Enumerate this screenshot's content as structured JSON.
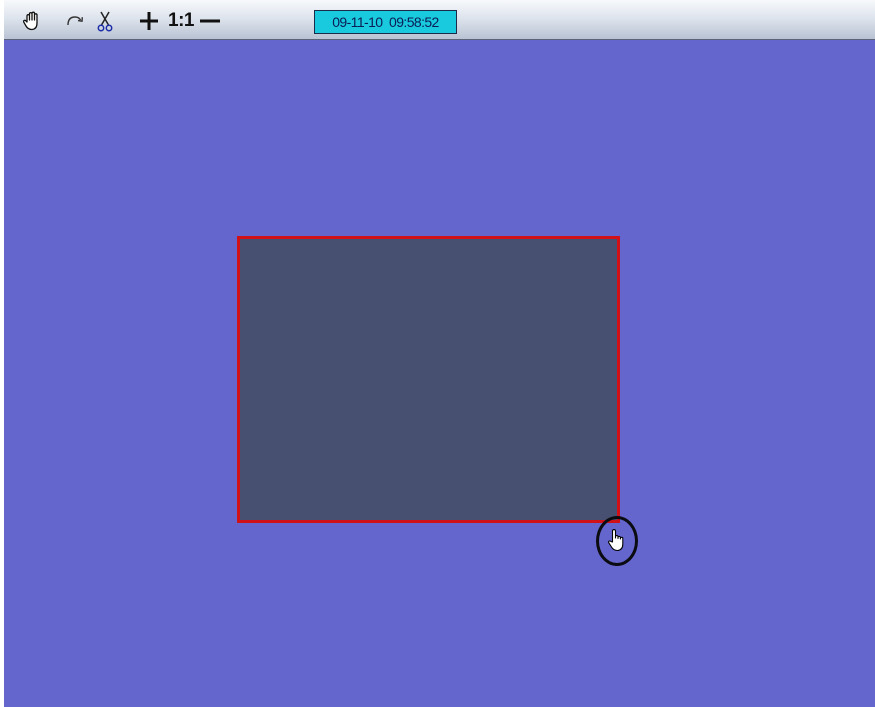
{
  "toolbar": {
    "tools": [
      {
        "name": "hand-tool",
        "icon": "hand-icon"
      },
      {
        "name": "rotate-tool",
        "icon": "rotate-arrow-icon"
      },
      {
        "name": "cut-tool",
        "icon": "scissors-icon"
      },
      {
        "name": "zoom-in-tool",
        "icon": "plus-icon"
      },
      {
        "name": "zoom-out-tool",
        "icon": "minus-icon"
      }
    ],
    "zoom_label": "1:1",
    "date": "09-11-10",
    "time": "09:58:52",
    "timestamp": "09-11-10  09:58:52"
  },
  "canvas": {
    "background_color": "#6566cd",
    "zone_fill_color": "#475070",
    "zone_border_color": "#d01218",
    "cursor_icon": "pointing-hand-cursor-icon",
    "highlight_icon": "highlight-circle"
  }
}
